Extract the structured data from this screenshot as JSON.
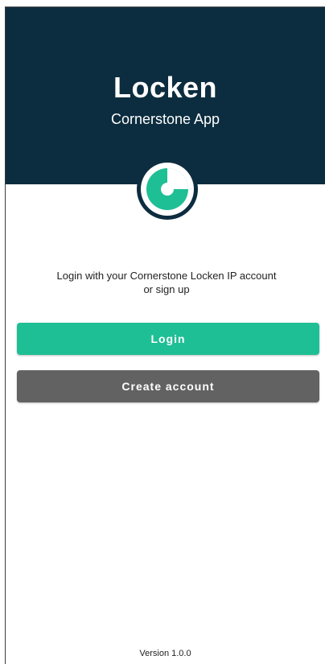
{
  "header": {
    "title": "Locken",
    "subtitle": "Cornerstone App"
  },
  "logo": {
    "icon": "cornerstone-logo-icon",
    "ring_color": "#0c2d3f",
    "accent_color": "#1fbf95"
  },
  "intro": {
    "line1": "Login with your Cornerstone Locken IP account",
    "line2": "or sign up"
  },
  "buttons": {
    "login_label": "Login",
    "create_account_label": "Create account"
  },
  "footer": {
    "version": "Version 1.0.0"
  },
  "colors": {
    "header_bg": "#0c2d3f",
    "primary": "#1fbf95",
    "secondary": "#626262"
  }
}
